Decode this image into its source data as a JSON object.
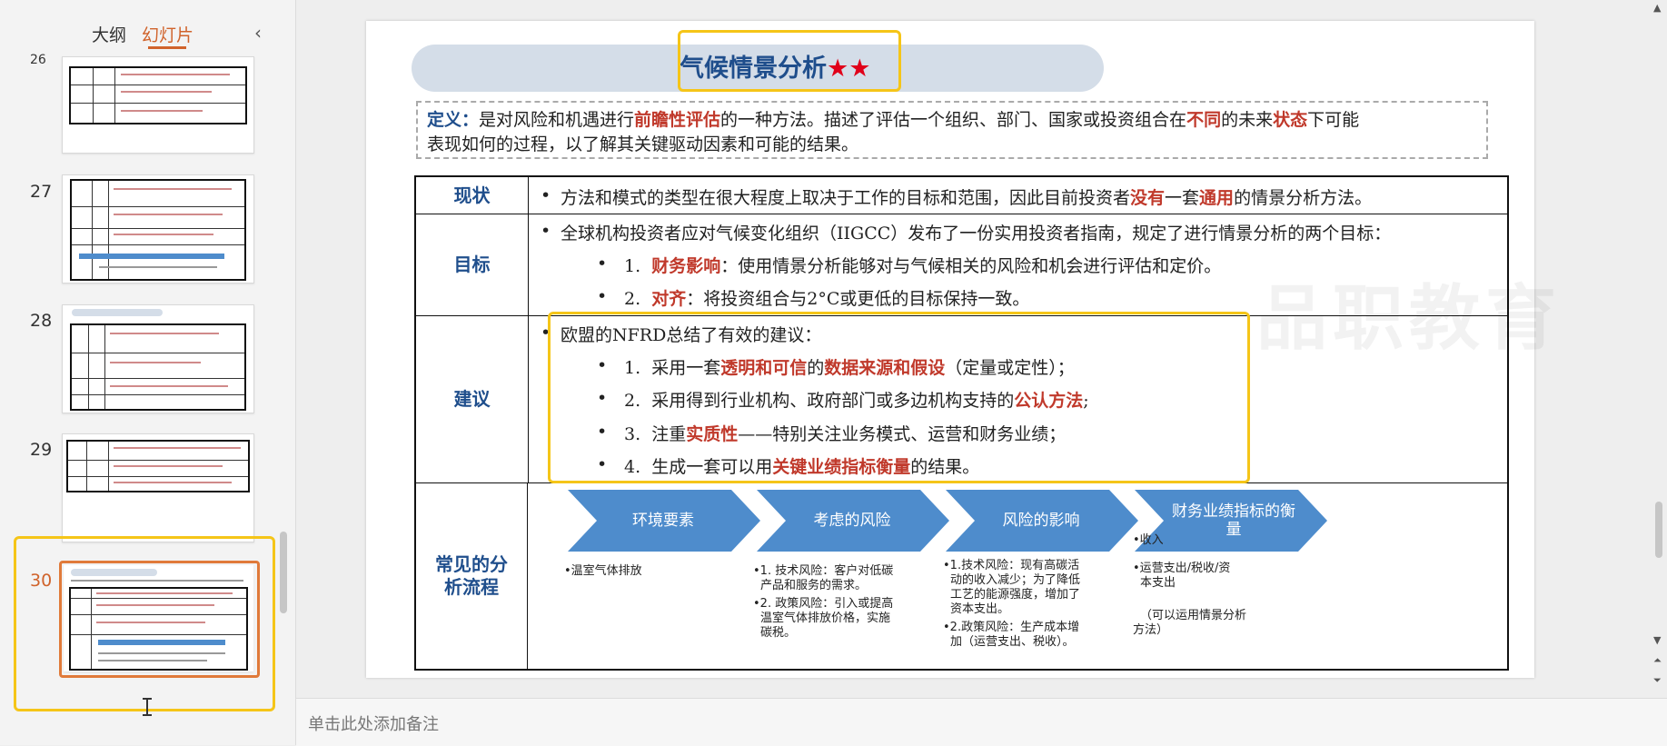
{
  "panel": {
    "tabs": [
      "大纲",
      "幻灯片"
    ],
    "active_tab": "幻灯片",
    "slide_numbers": [
      "26",
      "27",
      "28",
      "29",
      "30"
    ],
    "current_slide": "30"
  },
  "slide": {
    "title": "气候情景分析",
    "title_stars": "★★",
    "definition": {
      "label": "定义：",
      "t1": "是对风险和机遇进行",
      "r1": "前瞻性评估",
      "t2": "的一种方法。描述了评估一个组织、部门、国家或投资组合在",
      "r2": "不同",
      "t3": "的未来",
      "r3": "状态",
      "t4": "下可能",
      "line2": "表现如何的过程，以了解其关键驱动因素和可能的结果。"
    },
    "rows": {
      "status": {
        "label": "现状",
        "t1": "方法和模式的类型在很大程度上取决于工作的目标和范围，因此目前投资者",
        "r1": "没有",
        "t2": "一套",
        "r2": "通用",
        "t3": "的情景分析方法。"
      },
      "goal": {
        "label": "目标",
        "intro": "全球机构投资者应对气候变化组织（IIGCC）发布了一份实用投资者指南，规定了进行情景分析的两个目标：",
        "item1_num": "1.",
        "item1_red": "财务影响",
        "item1_text": "：使用情景分析能够对与气候相关的风险和机会进行评估和定价。",
        "item2_num": "2.",
        "item2_red": "对齐",
        "item2_text": "：将投资组合与2°C或更低的目标保持一致。"
      },
      "advice": {
        "label": "建议",
        "intro": "欧盟的NFRD总结了有效的建议：",
        "i1_num": "1.",
        "i1_t1": "采用一套",
        "i1_r1": "透明和可信",
        "i1_t2": "的",
        "i1_r2": "数据来源和假设",
        "i1_t3": "（定量或定性）；",
        "i2_num": "2.",
        "i2_t1": "采用得到行业机构、政府部门或多边机构支持的",
        "i2_r1": "公认方法",
        "i2_t2": ";",
        "i3_num": "3.",
        "i3_t1": "注重",
        "i3_r1": "实质性",
        "i3_t2": "——特别关注业务模式、运营和财务业绩；",
        "i4_num": "4.",
        "i4_t1": "生成一套可以用",
        "i4_r1": "关键业绩指标衡量",
        "i4_t2": "的结果。"
      },
      "process": {
        "label": "常见的分析流程",
        "steps": [
          "环境要素",
          "考虑的风险",
          "风险的影响",
          "财务业绩指标的衡量"
        ],
        "col1": [
          "•温室气体排放"
        ],
        "col2": [
          "•1. 技术风险：客户对低碳",
          "产品和服务的需求。",
          "•2. 政策风险：引入或提高",
          "温室气体排放价格，实施",
          "碳税。"
        ],
        "col3": [
          "•1.技术风险：现有高碳活",
          "动的收入减少；为了降低",
          "工艺的能源强度，增加了",
          "资本支出。",
          "•2.政策风险：生产成本增",
          "加（运营支出、税收）。"
        ],
        "col4": [
          "•收入",
          "•运营支出/税收/资",
          "本支出",
          "（可以运用情景分析",
          "方法）"
        ]
      }
    },
    "watermark": "品职教育"
  },
  "notes": {
    "placeholder": "单击此处添加备注"
  },
  "colors": {
    "accent": "#d0632b",
    "title_blue": "#1f4e8c",
    "red": "#c0392b",
    "chevron": "#4e8ccc",
    "highlight": "#f5c518"
  }
}
